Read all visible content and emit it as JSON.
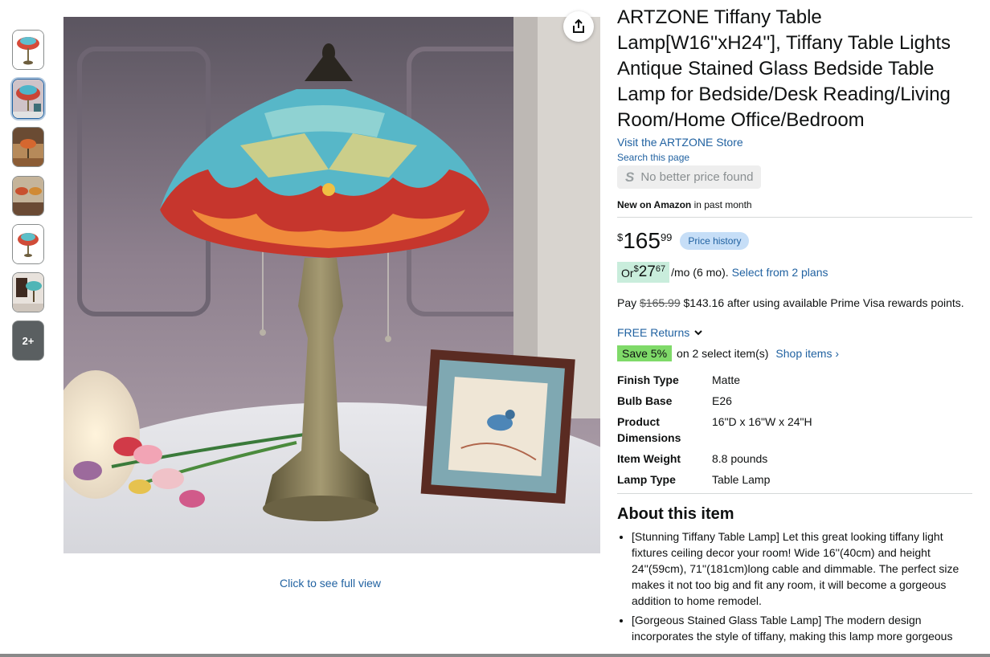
{
  "thumbnails": {
    "more_label": "2+"
  },
  "main_image": {
    "full_view_link": "Click to see full view"
  },
  "product": {
    "title": "ARTZONE Tiffany Table Lamp[W16''xH24''], Tiffany Table Lights Antique Stained Glass Bedside Table Lamp for Bedside/Desk Reading/Living Room/Home Office/Bedroom",
    "store_link": "Visit the ARTZONE Store",
    "search_page": "Search this page",
    "no_better_price": "No better price found",
    "new_on_amazon_bold": "New on Amazon",
    "new_on_amazon_rest": " in past month"
  },
  "price": {
    "symbol": "$",
    "whole": "165",
    "fraction": "99",
    "history_button": "Price history"
  },
  "monthly": {
    "or": "Or ",
    "symbol": "$",
    "whole": "27",
    "fraction": "67",
    "period": "/mo (6 mo).",
    "plans_link": "Select from 2 plans"
  },
  "pay": {
    "prefix": "Pay ",
    "original": "$165.99",
    "rest": " $143.16 after using available Prime Visa rewards points."
  },
  "returns": {
    "label": "FREE Returns"
  },
  "save": {
    "badge": "Save 5%",
    "text": "on 2 select item(s)",
    "link": "Shop items ›"
  },
  "specs": [
    {
      "key": "Finish Type",
      "value": "Matte"
    },
    {
      "key": "Bulb Base",
      "value": "E26"
    },
    {
      "key": "Product Dimensions",
      "value": "16\"D x 16\"W x 24\"H"
    },
    {
      "key": "Item Weight",
      "value": "8.8 pounds"
    },
    {
      "key": "Lamp Type",
      "value": "Table Lamp"
    }
  ],
  "about": {
    "heading": "About this item",
    "bullets": [
      "[Stunning Tiffany Table Lamp] Let this great looking tiffany light fixtures ceiling decor your room! Wide 16''(40cm) and height 24''(59cm), 71''(181cm)long cable and dimmable. The perfect size makes it not too big and fit any room, it will become a gorgeous addition to home remodel.",
      "[Gorgeous Stained Glass Table Lamp] The modern design incorporates the style of tiffany, making this lamp more gorgeous"
    ]
  }
}
